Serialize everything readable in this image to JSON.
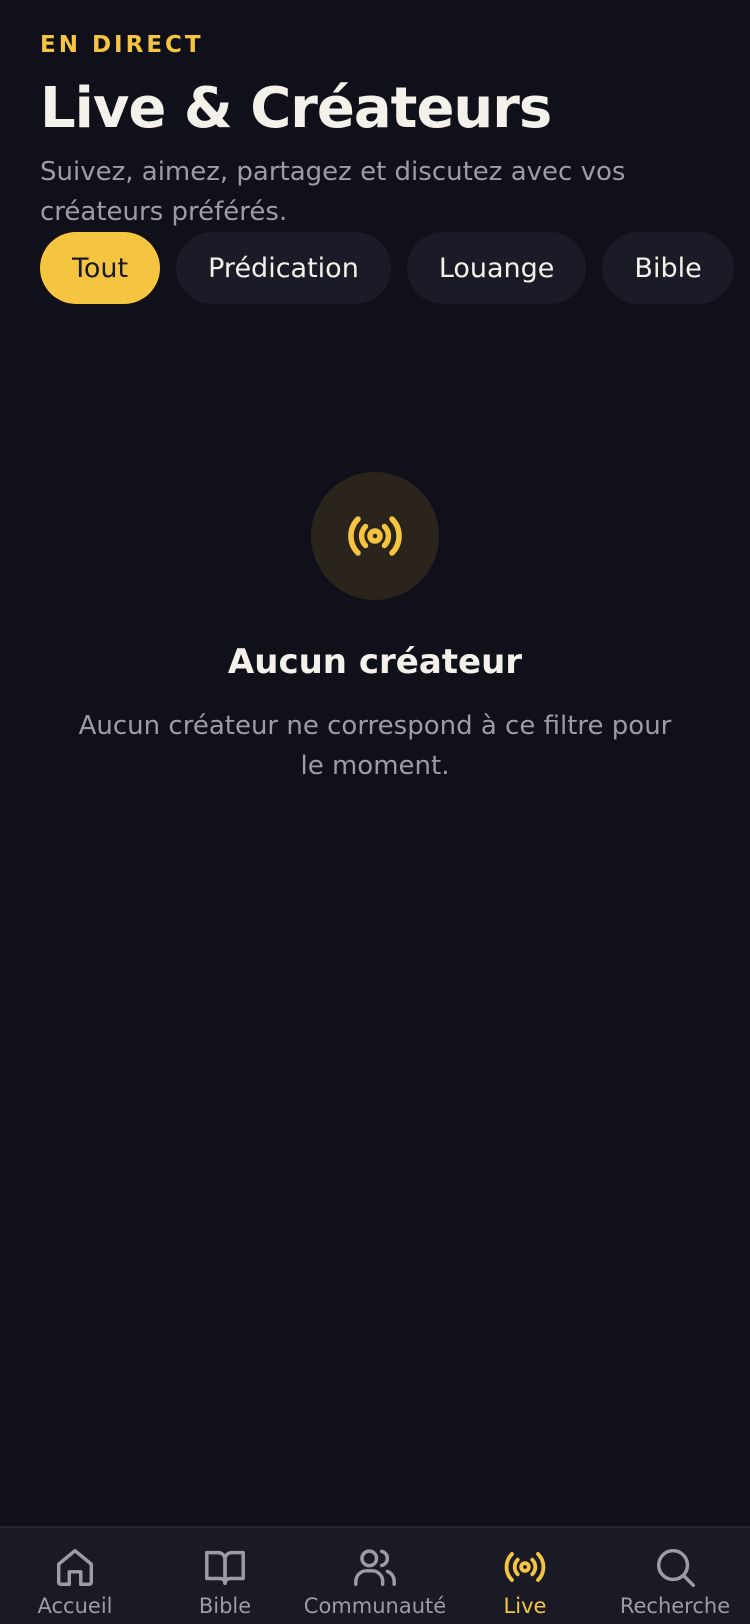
{
  "header": {
    "eyebrow": "EN DIRECT",
    "title": "Live & Créateurs",
    "subtitle": "Suivez, aimez, partagez et discutez avec vos créateurs préférés."
  },
  "filters": {
    "chips": [
      {
        "label": "Tout",
        "active": true
      },
      {
        "label": "Prédication",
        "active": false
      },
      {
        "label": "Louange",
        "active": false
      },
      {
        "label": "Bible",
        "active": false
      }
    ]
  },
  "empty_state": {
    "icon": "broadcast-icon",
    "title": "Aucun créateur",
    "message": "Aucun créateur ne correspond à ce filtre pour le moment."
  },
  "tabbar": {
    "items": [
      {
        "label": "Accueil",
        "icon": "home-icon",
        "active": false
      },
      {
        "label": "Bible",
        "icon": "book-icon",
        "active": false
      },
      {
        "label": "Communauté",
        "icon": "users-icon",
        "active": false
      },
      {
        "label": "Live",
        "icon": "broadcast-icon",
        "active": true
      },
      {
        "label": "Recherche",
        "icon": "search-icon",
        "active": false
      }
    ]
  },
  "colors": {
    "background": "#10101a",
    "accent": "#f5c542",
    "chip": "#1b1b27",
    "muted_text": "#9c9ca6"
  }
}
